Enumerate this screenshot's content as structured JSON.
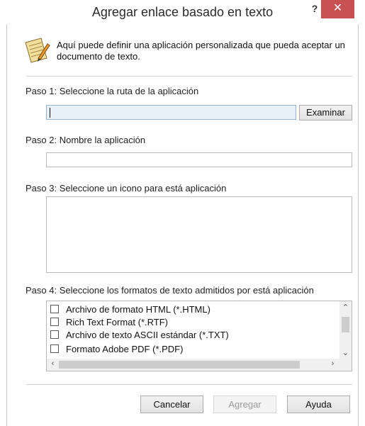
{
  "window": {
    "title": "Agregar enlace basado en texto",
    "help_glyph": "?",
    "close_glyph": "✕",
    "close_color": "#c75050"
  },
  "info": {
    "icon": "notepad-pencil-icon",
    "text": "Aquí puede definir una aplicación personalizada que pueda aceptar un documento de texto."
  },
  "step1": {
    "label": "Paso 1: Seleccione la ruta de la aplicación",
    "path_value": "",
    "browse_label": "Examinar"
  },
  "step2": {
    "label": "Paso 2: Nombre la aplicación",
    "name_value": ""
  },
  "step3": {
    "label": "Paso 3: Seleccione un icono para está aplicación"
  },
  "step4": {
    "label": "Paso 4: Seleccione los formatos de texto admitidos por está aplicación",
    "formats": [
      {
        "label": "Archivo de formato HTML (*.HTML)",
        "checked": false
      },
      {
        "label": "Rich Text Format (*.RTF)",
        "checked": false
      },
      {
        "label": "Archivo de texto ASCII estándar (*.TXT)",
        "checked": false
      },
      {
        "label": "Formato Adobe PDF (*.PDF)",
        "checked": false
      }
    ]
  },
  "buttons": {
    "cancel": "Cancelar",
    "add": "Agregar",
    "help": "Ayuda"
  }
}
